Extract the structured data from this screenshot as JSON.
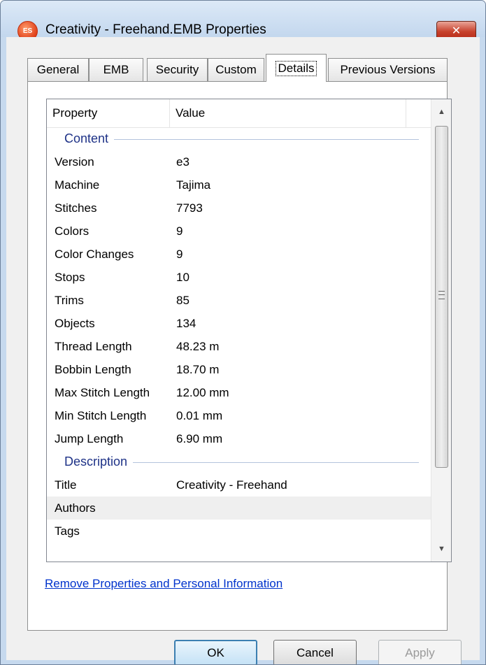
{
  "window": {
    "title": "Creativity - Freehand.EMB Properties",
    "app_icon_text": "ES",
    "close_glyph": "✕"
  },
  "tabs": [
    {
      "label": "General",
      "active": false
    },
    {
      "label": "EMB",
      "active": false
    },
    {
      "label": "Security",
      "active": false
    },
    {
      "label": "Custom",
      "active": false
    },
    {
      "label": "Details",
      "active": true
    },
    {
      "label": "Previous Versions",
      "active": false
    }
  ],
  "list": {
    "col_property": "Property",
    "col_value": "Value",
    "groups": [
      {
        "label": "Content",
        "rows": [
          {
            "property": "Version",
            "value": "e3"
          },
          {
            "property": "Machine",
            "value": "Tajima"
          },
          {
            "property": "Stitches",
            "value": "7793"
          },
          {
            "property": "Colors",
            "value": "9"
          },
          {
            "property": "Color Changes",
            "value": "9"
          },
          {
            "property": "Stops",
            "value": "10"
          },
          {
            "property": "Trims",
            "value": "85"
          },
          {
            "property": "Objects",
            "value": "134"
          },
          {
            "property": "Thread Length",
            "value": "48.23 m"
          },
          {
            "property": "Bobbin Length",
            "value": "18.70 m"
          },
          {
            "property": "Max Stitch Length",
            "value": "12.00 mm"
          },
          {
            "property": "Min Stitch Length",
            "value": "0.01 mm"
          },
          {
            "property": "Jump Length",
            "value": "6.90 mm"
          }
        ]
      },
      {
        "label": "Description",
        "rows": [
          {
            "property": "Title",
            "value": "Creativity - Freehand"
          },
          {
            "property": "Authors",
            "value": ""
          },
          {
            "property": "Tags",
            "value": ""
          }
        ]
      }
    ]
  },
  "remove_link": "Remove Properties and Personal Information",
  "buttons": {
    "ok": "OK",
    "cancel": "Cancel",
    "apply": "Apply"
  },
  "colors": {
    "group_label": "#1e3287",
    "link": "#0033cc",
    "close_button": "#c7402b"
  },
  "icons": {
    "app": "es-app-icon",
    "close": "close-icon",
    "scroll_up": "triangle-up-icon",
    "scroll_down": "triangle-down-icon",
    "grip": "scroll-grip-icon"
  }
}
